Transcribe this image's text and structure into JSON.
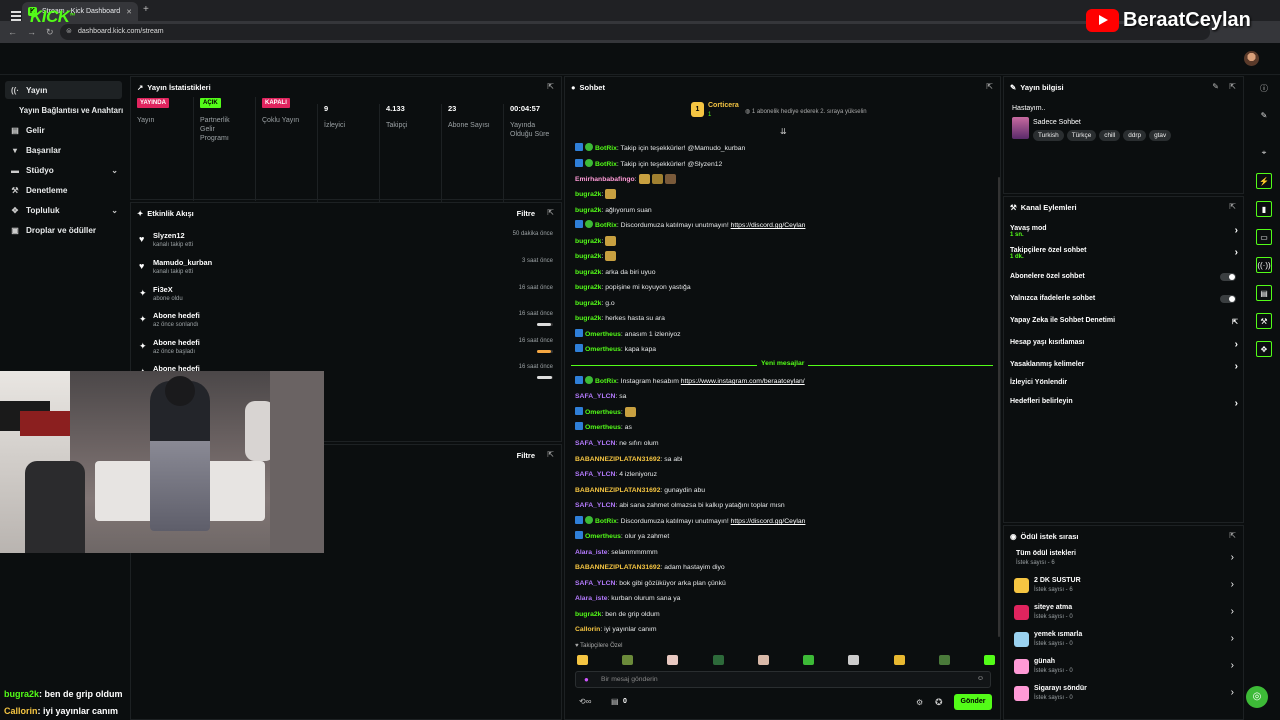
{
  "browser": {
    "tab_title": "Stream - Kick Dashboard",
    "url": "dashboard.kick.com/stream"
  },
  "overlay": {
    "channel_name": "BeraatCeylan"
  },
  "brand": {
    "logo": "KICK",
    "accent": "#53fc18"
  },
  "sidebar": {
    "items": [
      {
        "label": "Yayın",
        "icon": "broadcast-icon"
      },
      {
        "label": "Yayın Bağlantısı ve Anahtarı",
        "icon": ""
      },
      {
        "label": "Gelir",
        "icon": "wallet-icon"
      },
      {
        "label": "Başarılar",
        "icon": "trophy-icon"
      },
      {
        "label": "Stüdyo",
        "icon": "studio-icon"
      },
      {
        "label": "Denetleme",
        "icon": "hammer-icon"
      },
      {
        "label": "Topluluk",
        "icon": "community-icon"
      },
      {
        "label": "Droplar ve ödüller",
        "icon": "gift-icon"
      }
    ]
  },
  "stats": {
    "title": "Yayın İstatistikleri",
    "cols": [
      {
        "badge": "YAYINDA",
        "label": "Yayın"
      },
      {
        "badge": "AÇIK",
        "label": "Partnerlik Gelir Programı"
      },
      {
        "badge": "KAPALI",
        "label": "Çoklu Yayın"
      },
      {
        "value": "9",
        "label": "İzleyici"
      },
      {
        "value": "4.133",
        "label": "Takipçi"
      },
      {
        "value": "23",
        "label": "Abone Sayısı"
      },
      {
        "value": "00:04:57",
        "label": "Yayında Olduğu Süre"
      }
    ]
  },
  "activity": {
    "title": "Etkinlik Akışı",
    "filter": "Filtre",
    "items": [
      {
        "name": "Slyzen12",
        "sub": "kanalı takip etti",
        "time": "50 dakika önce"
      },
      {
        "name": "Mamudo_kurban",
        "sub": "kanalı takip etti",
        "time": "3 saat önce"
      },
      {
        "name": "Fi3eX",
        "sub": "abone oldu",
        "time": "16 saat önce"
      },
      {
        "name": "Abone hedefi",
        "sub": "az önce sonlandı",
        "time": "16 saat önce",
        "progress": 0.85
      },
      {
        "name": "Abone hedefi",
        "sub": "az önce başladı",
        "time": "16 saat önce",
        "progress": 0.9
      },
      {
        "name": "Abone hedefi",
        "sub": "",
        "time": "16 saat önce",
        "progress": 0.95
      }
    ]
  },
  "second_panel": {
    "filter": "Filtre"
  },
  "chat": {
    "title": "Sohbet",
    "gift_user": "Corticera",
    "gift_count": "1",
    "gift_rank": "1",
    "gift_text": "1 abonelik hediye ederek 2. sıraya yükselin",
    "new_messages": "Yeni mesajlar",
    "followers_only": "Takipçilere Özel",
    "input_placeholder": "Bir mesaj gönderin",
    "send": "Gönder",
    "points": "0",
    "messages": [
      {
        "user": "BotRix",
        "color": "#53fc18",
        "bot": true,
        "text": ": Takip için teşekkürler! @Mamudo_kurban"
      },
      {
        "user": "BotRix",
        "color": "#53fc18",
        "bot": true,
        "text": ": Takip için teşekkürler! @Slyzen12"
      },
      {
        "user": "Emirhanbabafingo",
        "color": "#ff9ad6",
        "text": ":",
        "emotes": 3
      },
      {
        "user": "bugra2k",
        "color": "#53fc18",
        "text": ":",
        "emotes": 1
      },
      {
        "user": "bugra2k",
        "color": "#53fc18",
        "text": ": ağlıyorum suan"
      },
      {
        "user": "BotRix",
        "color": "#53fc18",
        "bot": true,
        "text": ": Discordumuza katılmayı unutmayın! ",
        "link": "https://discord.gg/Ceylan"
      },
      {
        "user": "bugra2k",
        "color": "#53fc18",
        "text": ":",
        "emotes": 1
      },
      {
        "user": "bugra2k",
        "color": "#53fc18",
        "text": ":",
        "emotes": 1
      },
      {
        "user": "bugra2k",
        "color": "#53fc18",
        "text": ": arka da biri uyuo"
      },
      {
        "user": "bugra2k",
        "color": "#53fc18",
        "text": ": popişine mi koyuyon yastığa"
      },
      {
        "user": "bugra2k",
        "color": "#53fc18",
        "text": ": g.o"
      },
      {
        "user": "bugra2k",
        "color": "#53fc18",
        "text": ": herkes hasta su ara"
      },
      {
        "user": "Omertheus",
        "color": "#53fc18",
        "bot": "mod",
        "text": ": anasım 1 izleniyoz"
      },
      {
        "user": "Omertheus",
        "color": "#53fc18",
        "bot": "mod",
        "text": ": kapa kapa"
      },
      {
        "user": "BotRix",
        "color": "#53fc18",
        "bot": true,
        "text": ": Instagram hesabım ",
        "link": "https://www.instagram.com/beraatceylan/"
      },
      {
        "user": "SAFA_YLCN",
        "color": "#b57bff",
        "text": ": sa"
      },
      {
        "user": "Omertheus",
        "color": "#53fc18",
        "bot": "mod",
        "text": ":",
        "emotes": 1
      },
      {
        "user": "Omertheus",
        "color": "#53fc18",
        "bot": "mod",
        "text": ": as"
      },
      {
        "user": "SAFA_YLCN",
        "color": "#b57bff",
        "text": ": ne sıfırı olum"
      },
      {
        "user": "BABANNEZIPLATAN31692",
        "color": "#f5c542",
        "text": ": sa abi"
      },
      {
        "user": "SAFA_YLCN",
        "color": "#b57bff",
        "text": ": 4 izleniyoruz"
      },
      {
        "user": "BABANNEZIPLATAN31692",
        "color": "#f5c542",
        "text": ": gunaydin abu"
      },
      {
        "user": "SAFA_YLCN",
        "color": "#b57bff",
        "text": ": abi sana zahmet olmazsa bi kalkıp yatağını toplar mısn"
      },
      {
        "user": "BotRix",
        "color": "#53fc18",
        "bot": true,
        "text": ": Discordumuza katılmayı unutmayın! ",
        "link": "https://discord.gg/Ceylan"
      },
      {
        "user": "Omertheus",
        "color": "#53fc18",
        "bot": "mod",
        "text": ": olur ya zahmet"
      },
      {
        "user": "Alara_iste",
        "color": "#b57bff",
        "text": ": selammmmmm"
      },
      {
        "user": "BABANNEZIPLATAN31692",
        "color": "#f5c542",
        "text": ": adam hastayim diyo"
      },
      {
        "user": "SAFA_YLCN",
        "color": "#b57bff",
        "text": ": bok gibi gözüküyor arka plan çünkü"
      },
      {
        "user": "Alara_iste",
        "color": "#b57bff",
        "text": ": kurban olurum sana ya"
      },
      {
        "user": "bugra2k",
        "color": "#53fc18",
        "text": ": ben de grip oldum"
      },
      {
        "user": "Callorin",
        "color": "#f5c542",
        "text": ": iyi yayınlar canım"
      }
    ]
  },
  "stream_info": {
    "title": "Yayın bilgisi",
    "stream_title": "Hastayım..",
    "category": "Sadece Sohbet",
    "tags": [
      "Turkish",
      "Türkçe",
      "chill",
      "ddrp",
      "gtav"
    ]
  },
  "channel_actions": {
    "title": "Kanal Eylemleri",
    "items": [
      {
        "label": "Yavaş mod",
        "sub": "1 sn.",
        "control": "chevron"
      },
      {
        "label": "Takipçilere özel sohbet",
        "sub": "1 dk.",
        "control": "chevron"
      },
      {
        "label": "Abonelere özel sohbet",
        "control": "toggle"
      },
      {
        "label": "Yalnızca ifadelerle sohbet",
        "control": "toggle"
      },
      {
        "label": "Yapay Zeka ile Sohbet Denetimi",
        "control": "external"
      },
      {
        "label": "Hesap yaşı kısıtlaması",
        "control": "chevron"
      },
      {
        "label": "Yasaklanmış kelimeler",
        "control": "chevron"
      },
      {
        "label": "İzleyici Yönlendir",
        "control": "none"
      },
      {
        "label": "Hedefleri belirleyin",
        "control": "chevron"
      }
    ]
  },
  "rewards": {
    "title": "Ödül istek sırası",
    "items": [
      {
        "label": "Tüm ödül istekleri",
        "sub": "İstek sayısı - 6"
      },
      {
        "label": "2 DK SUSTUR",
        "sub": "İstek sayısı - 6",
        "color": "#f5c542"
      },
      {
        "label": "siteye atma",
        "sub": "İstek sayısı - 0",
        "color": "#e0245e"
      },
      {
        "label": "yemek ısmarla",
        "sub": "İstek sayısı - 0",
        "color": "#9ad2f0"
      },
      {
        "label": "günah",
        "sub": "İstek sayısı - 0",
        "color": "#ff9ad6"
      },
      {
        "label": "Sigarayı söndür",
        "sub": "İstek sayısı - 0",
        "color": "#ff9ad6"
      }
    ]
  },
  "overlay_chat": [
    {
      "user": "bugra2k",
      "text": ": ben de grip oldum",
      "color": "#53fc18"
    },
    {
      "user": "Callorin",
      "text": ": iyi yayınlar canım",
      "color": "#f5c542"
    }
  ]
}
